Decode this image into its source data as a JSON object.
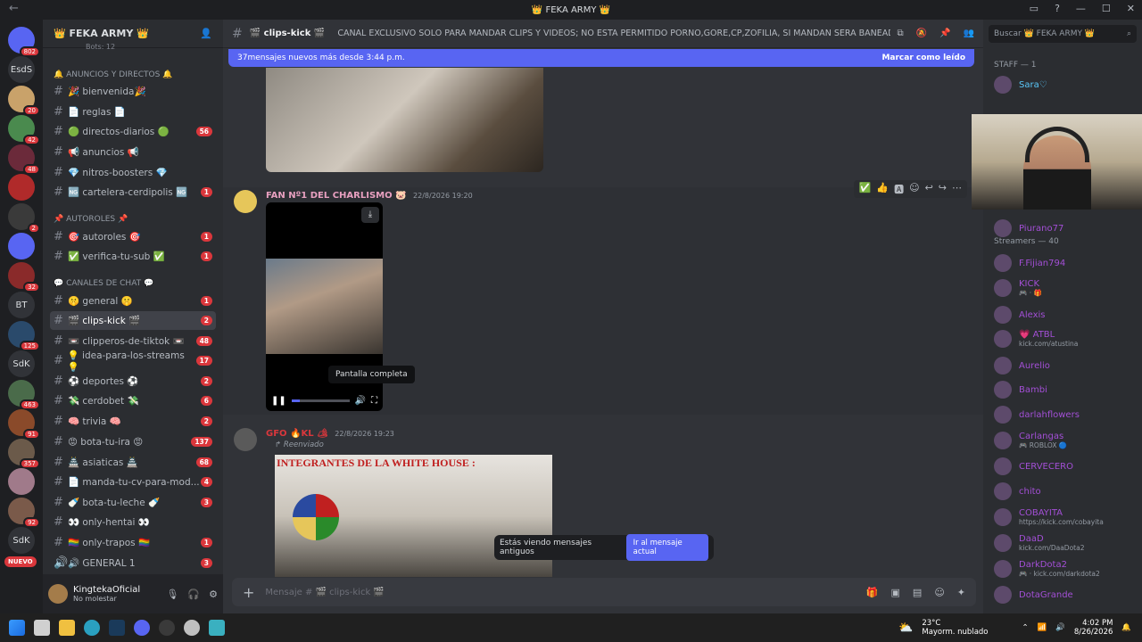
{
  "window": {
    "title": "👑 FEKA ARMY 👑"
  },
  "guilds": [
    {
      "label": "",
      "badge": "802",
      "color": "#5865f2"
    },
    {
      "label": "EsdS",
      "badge": "",
      "color": "#313338"
    },
    {
      "label": "",
      "badge": "20",
      "color": "#c9a26a"
    },
    {
      "label": "",
      "badge": "42",
      "color": "#4a8a4e"
    },
    {
      "label": "",
      "badge": "48",
      "color": "#6b2a3a"
    },
    {
      "label": "",
      "badge": "",
      "color": "#b02a2a"
    },
    {
      "label": "",
      "badge": "2",
      "color": "#3a3a3a"
    },
    {
      "label": "",
      "badge": "",
      "color": "#5865f2"
    },
    {
      "label": "",
      "badge": "32",
      "color": "#8a2a2a"
    },
    {
      "label": "BT",
      "badge": "",
      "color": "#313338"
    },
    {
      "label": "",
      "badge": "125",
      "color": "#2a4a6b"
    },
    {
      "label": "SdK",
      "badge": "",
      "color": "#313338"
    },
    {
      "label": "",
      "badge": "463",
      "color": "#4a6b4a"
    },
    {
      "label": "",
      "badge": "91",
      "color": "#8a4a2a"
    },
    {
      "label": "",
      "badge": "357",
      "color": "#6b5a4a"
    },
    {
      "label": "",
      "badge": "",
      "color": "#a07a8a"
    },
    {
      "label": "",
      "badge": "92",
      "color": "#7a5a4a"
    },
    {
      "label": "SdK",
      "badge": "",
      "color": "#313338"
    }
  ],
  "guild_new_label": "NUEVO",
  "server": {
    "name": "👑 FEKA ARMY 👑",
    "boosts_label": "Bots: 12"
  },
  "categories": [
    {
      "label": "🔔 ANUNCIOS Y DIRECTOS 🔔"
    },
    {
      "label": "📌 AUTOROLES 📌"
    },
    {
      "label": "💬 CANALES DE CHAT 💬"
    }
  ],
  "channels": [
    {
      "name": "🎉 bienvenida🎉",
      "count": ""
    },
    {
      "name": "📄 reglas 📄",
      "count": ""
    },
    {
      "name": "🟢 directos-diarios 🟢",
      "count": "56"
    },
    {
      "name": "📢 anuncios 📢",
      "count": ""
    },
    {
      "name": "💎 nitros-boosters 💎",
      "count": ""
    },
    {
      "name": "🆖 cartelera-cerdipolis 🆖",
      "count": "1"
    },
    {
      "name": "🎯 autoroles 🎯",
      "count": "1"
    },
    {
      "name": "✅ verifica-tu-sub ✅",
      "count": "1"
    },
    {
      "name": "🤫 general 🤫",
      "count": "1"
    },
    {
      "name": "🎬 clips-kick 🎬",
      "count": "2"
    },
    {
      "name": "📼 clipperos-de-tiktok 📼",
      "count": "48"
    },
    {
      "name": "💡 idea-para-los-streams 💡",
      "count": "17"
    },
    {
      "name": "⚽ deportes ⚽",
      "count": "2"
    },
    {
      "name": "💸 cerdobet 💸",
      "count": "6"
    },
    {
      "name": "🧠 trivia 🧠",
      "count": "2"
    },
    {
      "name": "😡 bota-tu-ira 😡",
      "count": "137"
    },
    {
      "name": "🏯 asiaticas 🏯",
      "count": "68"
    },
    {
      "name": "📄 manda-tu-cv-para-mod...",
      "count": "4"
    },
    {
      "name": "🍼 bota-tu-leche 🍼",
      "count": "3"
    },
    {
      "name": "👀 only-hentai 👀",
      "count": ""
    },
    {
      "name": "🏳️‍🌈 only-trapos 🏳️‍🌈",
      "count": "1"
    },
    {
      "name": "🔊 GENERAL 1",
      "count": "3"
    }
  ],
  "user": {
    "name": "KingtekaOficial",
    "status": "No molestar"
  },
  "channel": {
    "name": "🎬 clips-kick 🎬",
    "topic": "CANAL EXCLUSIVO SOLO PARA MANDAR CLIPS Y VIDEOS; NO ESTA PERMITIDO PORNO,GORE,CP,ZOFILIA, SI MANDAN SERA BANEADO PERMA..."
  },
  "newbar": {
    "text": "37mensajes nuevos más desde 3:44 p.m.",
    "action": "Marcar como leído"
  },
  "messages": [
    {
      "author": "FAN Nº1 DEL CHARLISMO 🐷",
      "time": "22/8/2026 19:20",
      "author_color": "#e8a0c0"
    },
    {
      "author": "GFO 🔥KL 🏕",
      "time": "22/8/2026 19:23",
      "author_color": "#da373c",
      "forwarded": "Reenviado"
    }
  ],
  "video_tooltip": "Pantalla completa",
  "forwarded_image_text": "INTEGRANTES DE LA WHITE HOUSE :",
  "toast": {
    "text": "Estás viendo mensajes antiguos",
    "button": "Ir al mensaje actual"
  },
  "composer": {
    "placeholder": "Mensaje # 🎬 clips-kick 🎬"
  },
  "members_search": "Buscar 👑 FEKA ARMY 👑",
  "member_groups": [
    {
      "label": "STAFF — 1"
    },
    {
      "label": "Streamers — 40"
    }
  ],
  "members": [
    {
      "name": "Sara♡",
      "sub": "",
      "color": "#5ac8fa"
    },
    {
      "name": "Piurano77",
      "sub": "",
      "color": "#a34fd6"
    },
    {
      "name": "F.Fijian794",
      "sub": "",
      "color": "#a34fd6"
    },
    {
      "name": "KICK",
      "sub": "🎮 · 🎁",
      "color": "#a34fd6"
    },
    {
      "name": "Alexis",
      "sub": "",
      "color": "#a34fd6"
    },
    {
      "name": "💗 ATBL",
      "sub": "kick.com/atustina",
      "color": "#a34fd6"
    },
    {
      "name": "Aurelio",
      "sub": "",
      "color": "#a34fd6"
    },
    {
      "name": "Bambi",
      "sub": "",
      "color": "#a34fd6"
    },
    {
      "name": "darlahflowers",
      "sub": "",
      "color": "#a34fd6"
    },
    {
      "name": "Carlangas",
      "sub": "🎮 ROBLOX 🔵",
      "color": "#a34fd6"
    },
    {
      "name": "CERVECERO",
      "sub": "",
      "color": "#a34fd6"
    },
    {
      "name": "chito",
      "sub": "",
      "color": "#a34fd6"
    },
    {
      "name": "COBAYITA",
      "sub": "https://kick.com/cobayita",
      "color": "#a34fd6"
    },
    {
      "name": "DaaD",
      "sub": "kick.com/DaaDota2",
      "color": "#a34fd6"
    },
    {
      "name": "DarkDota2",
      "sub": "🎮 · kick.com/darkdota2",
      "color": "#a34fd6"
    },
    {
      "name": "DotaGrande",
      "sub": "",
      "color": "#a34fd6"
    }
  ],
  "taskbar": {
    "weather_temp": "23°C",
    "weather_desc": "Mayorm. nublado",
    "time": "4:02 PM",
    "date": "8/26/2026"
  }
}
